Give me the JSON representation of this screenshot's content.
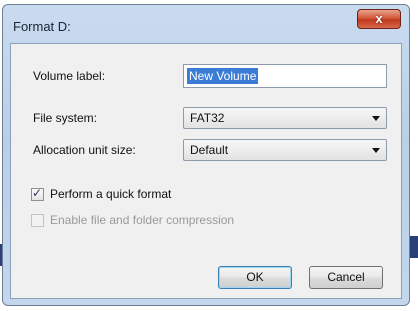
{
  "window": {
    "title": "Format D:",
    "close_label": "x"
  },
  "form": {
    "volume_label": {
      "label": "Volume label:",
      "value": "New Volume"
    },
    "file_system": {
      "label": "File system:",
      "selected": "FAT32"
    },
    "allocation_unit": {
      "label": "Allocation unit size:",
      "selected": "Default"
    }
  },
  "options": {
    "quick_format": {
      "label": "Perform a quick format",
      "checked": true
    },
    "compression": {
      "label": "Enable file and folder compression",
      "checked": false,
      "enabled": false
    }
  },
  "buttons": {
    "ok": "OK",
    "cancel": "Cancel"
  },
  "colors": {
    "title_bar": "#c9dbef",
    "close_button": "#c0381d",
    "selection": "#3a7cd6"
  }
}
